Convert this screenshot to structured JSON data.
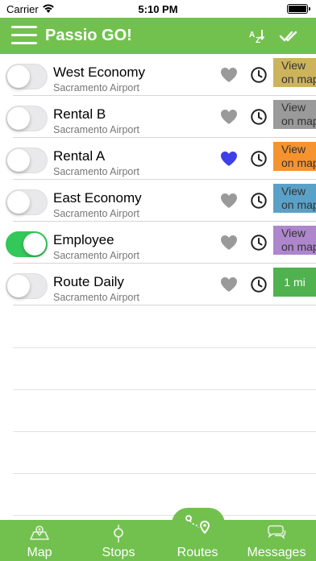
{
  "status_bar": {
    "carrier": "Carrier",
    "time": "5:10 PM"
  },
  "header": {
    "title": "Passio GO!",
    "sort_icon": "sort-az-icon",
    "select_icon": "double-check-icon",
    "menu_icon": "hamburger-icon"
  },
  "routes": [
    {
      "name": "West Economy",
      "subtitle": "Sacramento Airport",
      "enabled": false,
      "favorite": false,
      "button_line1": "View",
      "button_line2": "on map",
      "button_color": "#cdb45c"
    },
    {
      "name": "Rental B",
      "subtitle": "Sacramento Airport",
      "enabled": false,
      "favorite": false,
      "button_line1": "View",
      "button_line2": "on map",
      "button_color": "#9a9a9a"
    },
    {
      "name": "Rental A",
      "subtitle": "Sacramento Airport",
      "enabled": false,
      "favorite": true,
      "button_line1": "View",
      "button_line2": "on map",
      "button_color": "#f5932f"
    },
    {
      "name": "East Economy",
      "subtitle": "Sacramento Airport",
      "enabled": false,
      "favorite": false,
      "button_line1": "View",
      "button_line2": "on map",
      "button_color": "#5aa1c8"
    },
    {
      "name": "Employee",
      "subtitle": "Sacramento Airport",
      "enabled": true,
      "favorite": false,
      "button_line1": "View",
      "button_line2": "on map",
      "button_color": "#ad86cc"
    },
    {
      "name": "Route Daily",
      "subtitle": "Sacramento Airport",
      "enabled": false,
      "favorite": false,
      "button_line1": "1 mi",
      "button_line2": "",
      "button_color": "#4fb24f"
    }
  ],
  "tabs": [
    {
      "label": "Map",
      "icon": "map-icon",
      "active": false
    },
    {
      "label": "Stops",
      "icon": "stop-pin-icon",
      "active": false
    },
    {
      "label": "Routes",
      "icon": "route-icon",
      "active": true
    },
    {
      "label": "Messages",
      "icon": "chat-bubbles-icon",
      "active": false
    }
  ],
  "colors": {
    "brand_green": "#72c14f",
    "favorite_on": "#3f3fe8",
    "favorite_off": "#9a9a9a",
    "toggle_on": "#34c759"
  }
}
